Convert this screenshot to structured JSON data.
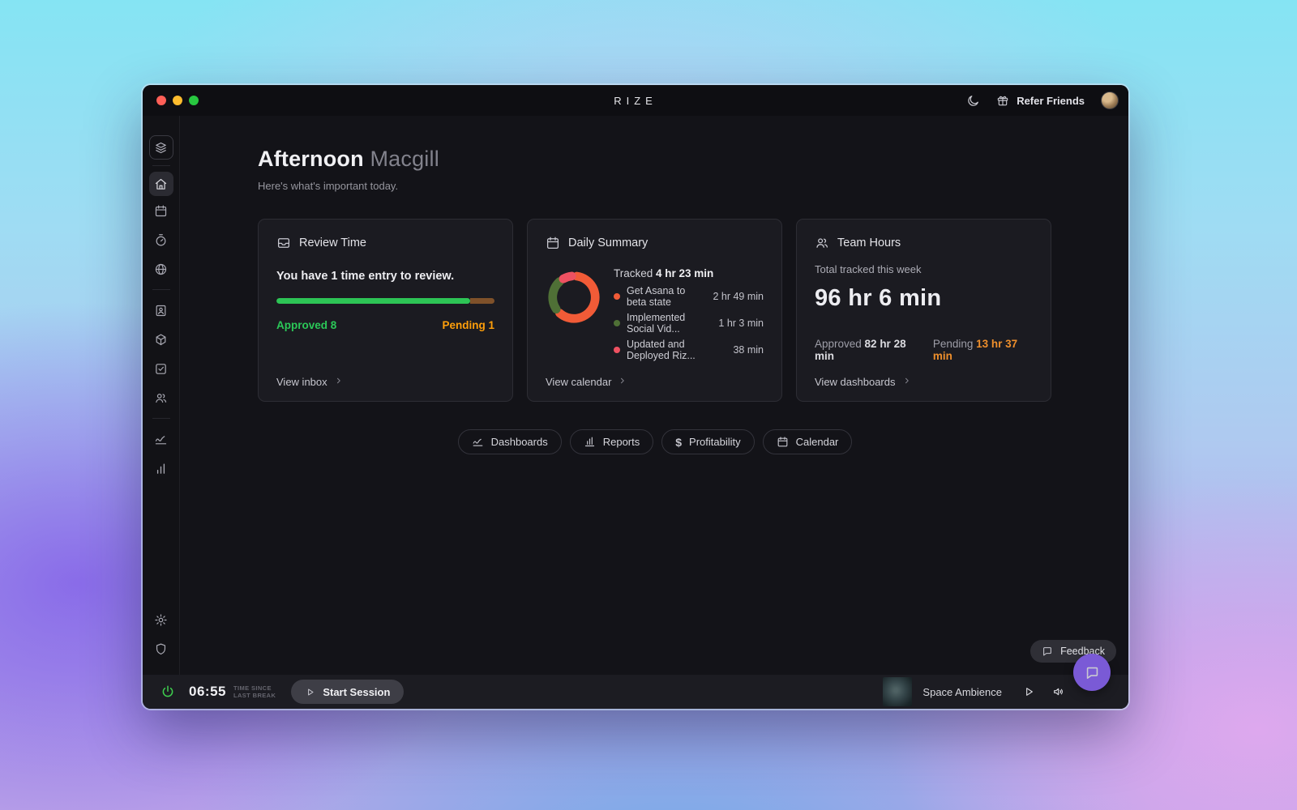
{
  "window": {
    "title": "RIZE"
  },
  "titlebar": {
    "refer_friends": "Refer Friends"
  },
  "greeting": {
    "word": "Afternoon",
    "name": "Macgill",
    "subtitle": "Here's what's important today."
  },
  "cards": {
    "review": {
      "title": "Review Time",
      "msg_prefix": "You have ",
      "msg_count": "1",
      "msg_suffix": " time entry to review.",
      "progress_width": "89%",
      "progress_color": "#2dc455",
      "progress_rest_color": "#7f512a",
      "approved_label": "Approved 8",
      "approved_color": "#2bc858",
      "pending_label": "Pending 1",
      "pending_color": "#ff9f0a",
      "link": "View inbox"
    },
    "daily": {
      "title": "Daily Summary",
      "tracked_label": "Tracked ",
      "tracked_value": "4 hr 23 min",
      "legend": [
        {
          "name": "Get Asana to beta state",
          "value": "2 hr 49 min",
          "color": "#f15b37"
        },
        {
          "name": "Implemented Social Vid...",
          "value": "1 hr 3 min",
          "color": "#4f7036"
        },
        {
          "name": "Updated and Deployed Riz...",
          "value": "38 min",
          "color": "#ee5161"
        }
      ],
      "link": "View calendar"
    },
    "team": {
      "title": "Team Hours",
      "subtitle": "Total tracked this week",
      "total": "96 hr 6 min",
      "approved_label": "Approved ",
      "approved_value": "82 hr 28 min",
      "pending_label": "Pending ",
      "pending_value": "13 hr 37 min",
      "pending_color": "#ee8f2c",
      "link": "View dashboards"
    }
  },
  "quick_nav": [
    {
      "label": "Dashboards"
    },
    {
      "label": "Reports"
    },
    {
      "label": "Profitability",
      "symbol": "$"
    },
    {
      "label": "Calendar"
    }
  ],
  "footer": {
    "timer": "06:55",
    "caption_line1": "TIME SINCE",
    "caption_line2": "LAST BREAK",
    "start_button": "Start Session",
    "track_name": "Space Ambience"
  },
  "feedback": {
    "label": "Feedback"
  }
}
